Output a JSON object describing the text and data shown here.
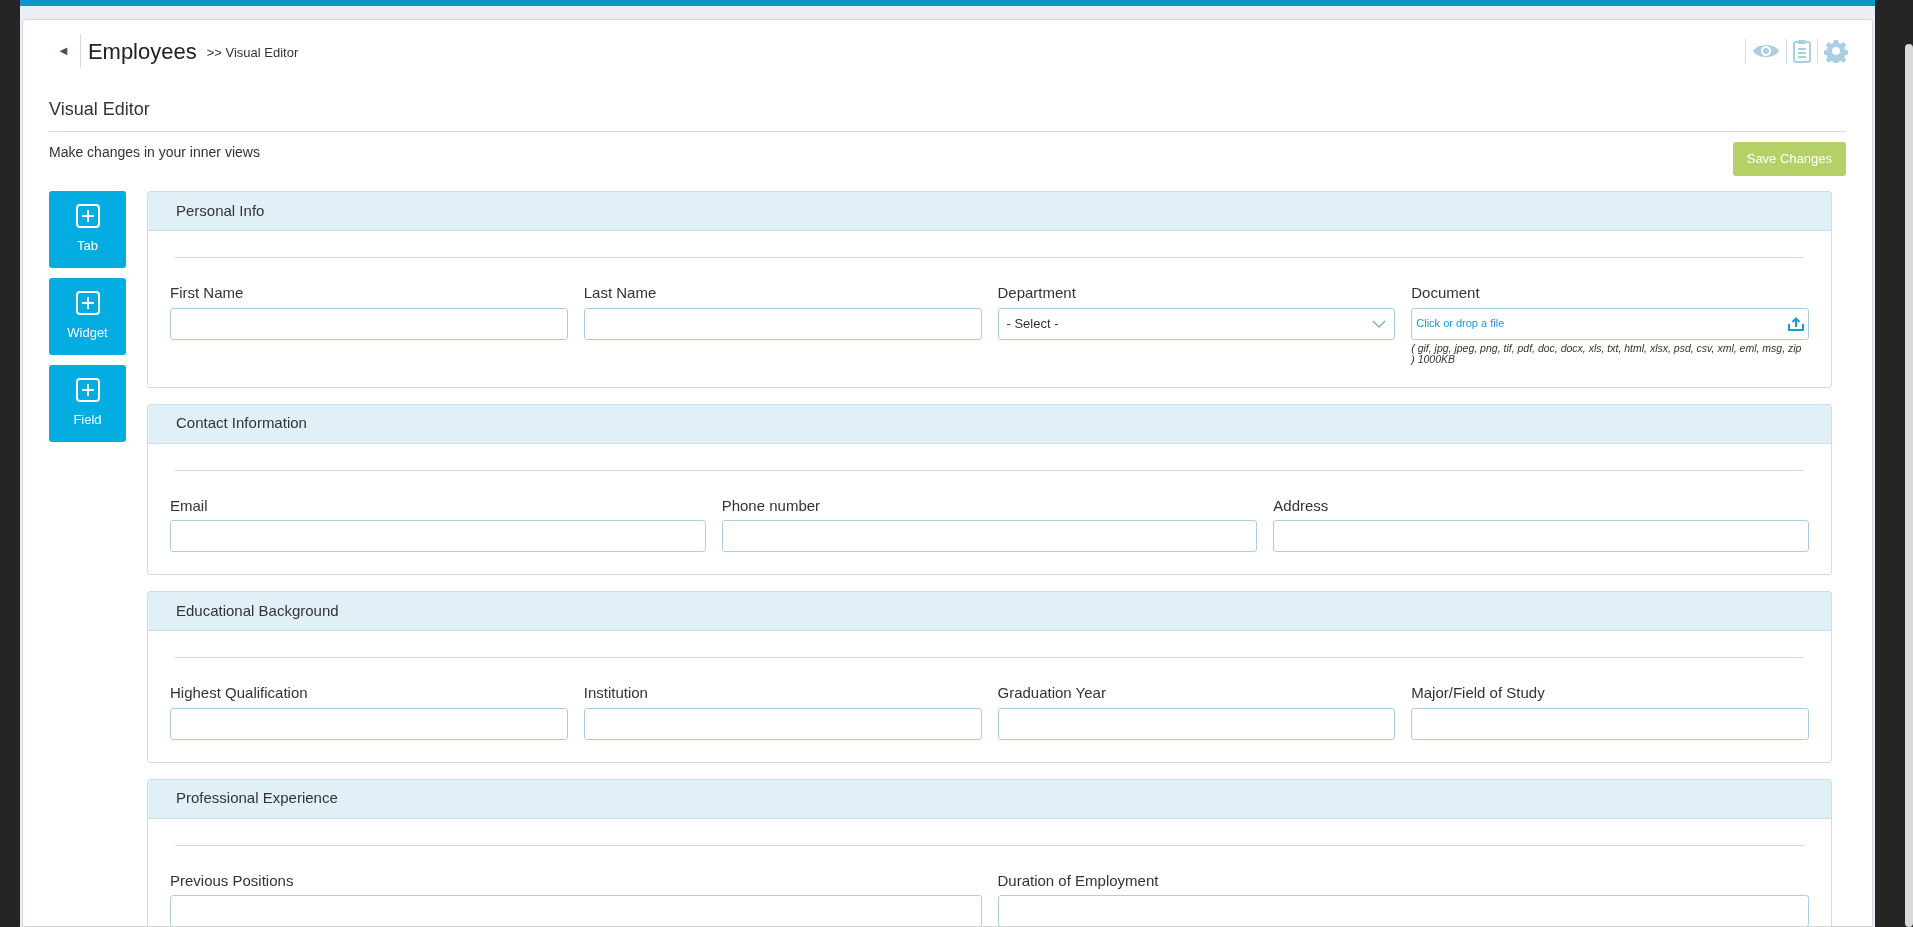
{
  "header": {
    "back": "◄",
    "title": "Employees",
    "breadcrumb": ">> Visual Editor"
  },
  "page": {
    "heading": "Visual Editor",
    "subtitle": "Make changes in your inner views",
    "save_button": "Save Changes"
  },
  "tools": [
    {
      "label": "Tab"
    },
    {
      "label": "Widget"
    },
    {
      "label": "Field"
    }
  ],
  "sections": [
    {
      "title": "Personal Info",
      "fields": [
        {
          "label": "First Name",
          "kind": "text"
        },
        {
          "label": "Last Name",
          "kind": "text"
        },
        {
          "label": "Department",
          "kind": "select",
          "value": "- Select -"
        },
        {
          "label": "Document",
          "kind": "file",
          "placeholder": "Click or drop a file",
          "hint": "( gif, jpg, jpeg, png, tif, pdf, doc, docx, xls, txt, html, xlsx, psd, csv, xml, eml, msg, zip ) 1000KB"
        }
      ]
    },
    {
      "title": "Contact Information",
      "fields": [
        {
          "label": "Email",
          "kind": "text"
        },
        {
          "label": "Phone number",
          "kind": "text"
        },
        {
          "label": "Address",
          "kind": "text"
        }
      ]
    },
    {
      "title": "Educational Background",
      "fields": [
        {
          "label": "Highest Qualification",
          "kind": "text"
        },
        {
          "label": "Institution",
          "kind": "text"
        },
        {
          "label": "Graduation Year",
          "kind": "text"
        },
        {
          "label": "Major/Field of Study",
          "kind": "text"
        }
      ]
    },
    {
      "title": "Professional Experience",
      "fields": [
        {
          "label": "Previous Positions",
          "kind": "text"
        },
        {
          "label": "Duration of Employment",
          "kind": "text"
        }
      ]
    }
  ]
}
